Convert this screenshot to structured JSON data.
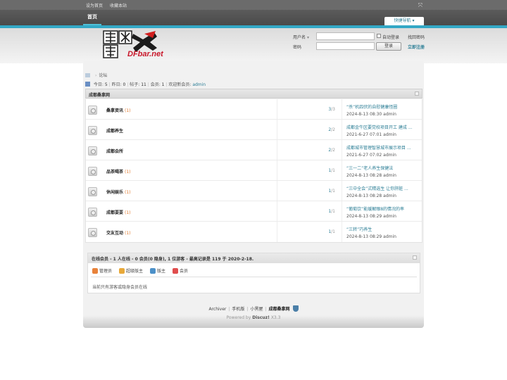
{
  "topbar": {
    "set_home": "设为首页",
    "bookmark": "收藏本站"
  },
  "nav": {
    "home": "首页",
    "quick_nav": "快捷导航"
  },
  "login": {
    "username_label": "用户名",
    "password_label": "密码",
    "auto_login": "自动登录",
    "find_password": "找回密码",
    "login_button": "登录",
    "register": "立即注册",
    "username_value": "",
    "password_value": ""
  },
  "logo_text": "DFbar.net",
  "breadcrumb": {
    "current": "论坛"
  },
  "stats": {
    "today_label": "今日:",
    "today": "5",
    "yesterday_label": "昨日:",
    "yesterday": "0",
    "posts_label": "帖子:",
    "posts": "11",
    "members_label": "会员:",
    "members": "1",
    "welcome_label": "欢迎新会员:",
    "newest": "admin"
  },
  "category": {
    "title": "成都桑拿网"
  },
  "forums": [
    {
      "name": "桑拿资讯",
      "today": "(1)",
      "threads": "3",
      "posts": "3",
      "last_subject": "“杀”机四伏的自慰健康怪圈",
      "last_date": "2024-8-13 08:30",
      "last_user": "admin"
    },
    {
      "name": "成都养生",
      "today": "",
      "threads": "2",
      "posts": "2",
      "last_subject": "成都金牛区要党校项目开工 建成 ...",
      "last_date": "2021-6-27 07:01",
      "last_user": "admin"
    },
    {
      "name": "成都会所",
      "today": "",
      "threads": "2",
      "posts": "2",
      "last_subject": "成都城市管理智慧城市展示项目 ...",
      "last_date": "2021-6-27 07:02",
      "last_user": "admin"
    },
    {
      "name": "品茶喝茶",
      "today": "(1)",
      "threads": "1",
      "posts": "1",
      "last_subject": "“三一二”老人养生保健法",
      "last_date": "2024-8-13 08:28",
      "last_user": "admin"
    },
    {
      "name": "休闲娱乐",
      "today": "(1)",
      "threads": "1",
      "posts": "1",
      "last_subject": "“三中全会”式精选生 让你肝脏 ...",
      "last_date": "2024-8-13 08:28",
      "last_user": "admin"
    },
    {
      "name": "成都耍耍",
      "today": "(1)",
      "threads": "1",
      "posts": "1",
      "last_subject": "“葡萄饮”能缓解眼8的情况的率",
      "last_date": "2024-8-13 08:29",
      "last_user": "admin"
    },
    {
      "name": "交友互动",
      "today": "(1)",
      "threads": "1",
      "posts": "1",
      "last_subject": "“三转”巧养生",
      "last_date": "2024-8-13 08:29",
      "last_user": "admin"
    }
  ],
  "online": {
    "header": "在线会员 - 1 人在线 - 0 会员(0 隐身), 1 位游客 - 最高记录是 119 于 2020-2-18.",
    "legend": [
      "管理员",
      "超级版主",
      "版主",
      "会员"
    ],
    "legend_colors": [
      "#e8823a",
      "#e8a93a",
      "#4c90c8",
      "#e04d4d"
    ],
    "none": "当前只有游客或隐身会员在线"
  },
  "footer": {
    "archiver": "Archiver",
    "mobile": "手机版",
    "blackroom": "小黑屋",
    "site": "成都桑拿网"
  },
  "powered": {
    "prefix": "Powered by",
    "name": "Discuz!",
    "version": "X3.3"
  },
  "sep": "|",
  "cnt_sep": "/"
}
